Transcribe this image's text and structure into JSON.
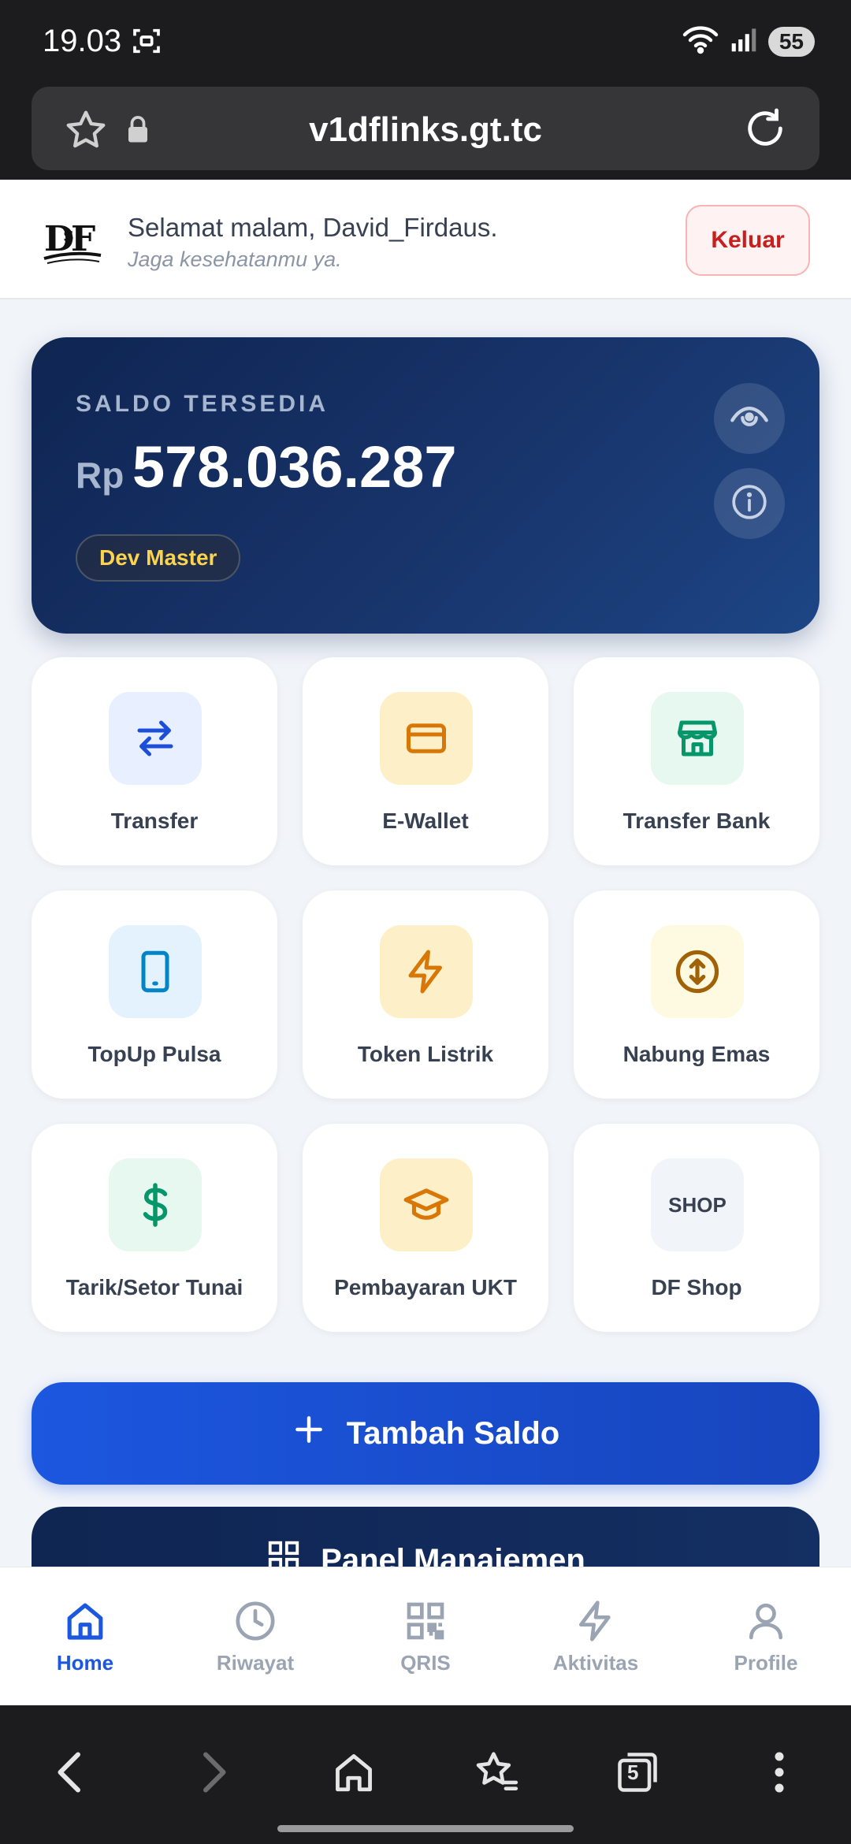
{
  "status_bar": {
    "time": "19.03",
    "battery": "55"
  },
  "browser": {
    "url": "v1dflinks.gt.tc"
  },
  "header": {
    "greeting": "Selamat malam, David_Firdaus.",
    "subtitle": "Jaga kesehatanmu ya.",
    "logout_label": "Keluar"
  },
  "balance_card": {
    "label": "SALDO TERSEDIA",
    "currency": "Rp",
    "amount": "578.036.287",
    "badge": "Dev Master"
  },
  "services": [
    {
      "label": "Transfer",
      "icon": "transfer-arrows-icon",
      "color": "#1d4ed8",
      "bg": "#e8efff"
    },
    {
      "label": "E-Wallet",
      "icon": "card-icon",
      "color": "#d97706",
      "bg": "#fdf0c9"
    },
    {
      "label": "Transfer Bank",
      "icon": "bank-store-icon",
      "color": "#059669",
      "bg": "#e6f8f0"
    },
    {
      "label": "TopUp Pulsa",
      "icon": "phone-icon",
      "color": "#0284c7",
      "bg": "#e3f2fc"
    },
    {
      "label": "Token Listrik",
      "icon": "lightning-icon",
      "color": "#d97706",
      "bg": "#fdf0c9"
    },
    {
      "label": "Nabung Emas",
      "icon": "gold-arrows-circle-icon",
      "color": "#a16207",
      "bg": "#fef9e1"
    },
    {
      "label": "Tarik/Setor Tunai",
      "icon": "dollar-icon",
      "color": "#059669",
      "bg": "#e6f8f0"
    },
    {
      "label": "Pembayaran UKT",
      "icon": "graduation-cap-icon",
      "color": "#d97706",
      "bg": "#fdf0c9"
    },
    {
      "label": "DF Shop",
      "icon": "shop-text-icon",
      "icon_text": "SHOP",
      "color": "#374151",
      "bg": "#f1f4f9"
    }
  ],
  "actions": {
    "topup_label": "Tambah Saldo",
    "panel_label": "Panel Manajemen"
  },
  "bottom_nav": [
    {
      "label": "Home",
      "active": true
    },
    {
      "label": "Riwayat",
      "active": false
    },
    {
      "label": "QRIS",
      "active": false
    },
    {
      "label": "Aktivitas",
      "active": false
    },
    {
      "label": "Profile",
      "active": false
    }
  ],
  "system_nav": {
    "tabs_count": "5"
  },
  "colors": {
    "accent": "#1c57e0",
    "navy": "#0f2552",
    "danger": "#c81e1e"
  }
}
